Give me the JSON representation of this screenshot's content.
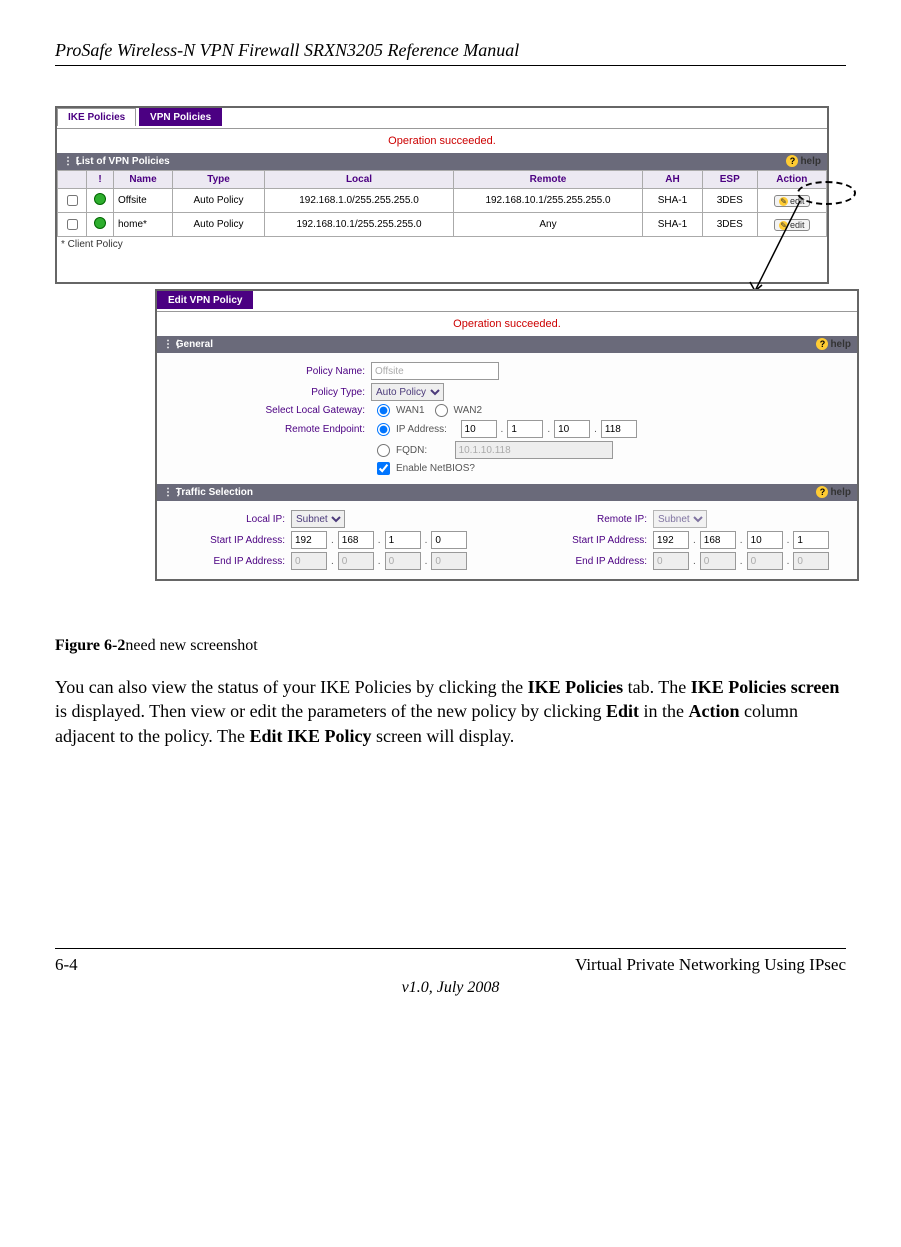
{
  "doc": {
    "header": "ProSafe Wireless-N VPN Firewall SRXN3205 Reference Manual",
    "figure_label": "Figure 6-2",
    "figure_note": "need new screenshot",
    "body_1a": "You can also view the status of your IKE Policies by clicking the ",
    "body_1b": "IKE Policies",
    "body_1c": " tab. The ",
    "body_1d": "IKE Policies screen",
    "body_1e": " is displayed. Then view or edit the parameters of the new policy by clicking ",
    "body_1f": "Edit",
    "body_1g": " in the ",
    "body_1h": "Action",
    "body_1i": " column adjacent to the policy. The ",
    "body_1j": "Edit IKE Policy",
    "body_1k": " screen will display.",
    "footer_left": "6-4",
    "footer_right": "Virtual Private Networking Using IPsec",
    "footer_center": "v1.0, July 2008"
  },
  "panel1": {
    "tab_ike": "IKE Policies",
    "tab_vpn": "VPN Policies",
    "op": "Operation succeeded.",
    "list_title": "List of VPN Policies",
    "help": "help",
    "cols": {
      "bang": "!",
      "name": "Name",
      "type": "Type",
      "local": "Local",
      "remote": "Remote",
      "ah": "AH",
      "esp": "ESP",
      "action": "Action"
    },
    "rows": [
      {
        "name": "Offsite",
        "type": "Auto Policy",
        "local": "192.168.1.0/255.255.255.0",
        "remote": "192.168.10.1/255.255.255.0",
        "ah": "SHA-1",
        "esp": "3DES",
        "edit": "edit"
      },
      {
        "name": "home*",
        "type": "Auto Policy",
        "local": "192.168.10.1/255.255.255.0",
        "remote": "Any",
        "ah": "SHA-1",
        "esp": "3DES",
        "edit": "edit"
      }
    ],
    "footnote": "* Client Policy"
  },
  "panel2": {
    "tab": "Edit VPN Policy",
    "op": "Operation succeeded.",
    "general": "General",
    "help": "help",
    "labels": {
      "policy_name": "Policy Name:",
      "policy_type": "Policy Type:",
      "select_gw": "Select Local Gateway:",
      "remote_ep": "Remote Endpoint:",
      "ip_addr": "IP Address:",
      "fqdn": "FQDN:",
      "netbios": "Enable NetBIOS?"
    },
    "values": {
      "policy_name": "Offsite",
      "policy_type": "Auto Policy",
      "wan1": "WAN1",
      "wan2": "WAN2",
      "ip1": "10",
      "ip2": "1",
      "ip3": "10",
      "ip4": "118",
      "fqdn_val": "10.1.10.118"
    },
    "traffic": "Traffic Selection",
    "ts_labels": {
      "local_ip": "Local IP:",
      "remote_ip": "Remote IP:",
      "start_ip": "Start IP Address:",
      "end_ip": "End IP Address:"
    },
    "ts_values": {
      "local_sel": "Subnet",
      "remote_sel": "Subnet",
      "l_start": [
        "192",
        "168",
        "1",
        "0"
      ],
      "l_end": [
        "0",
        "0",
        "0",
        "0"
      ],
      "r_start": [
        "192",
        "168",
        "10",
        "1"
      ],
      "r_end": [
        "0",
        "0",
        "0",
        "0"
      ]
    }
  }
}
